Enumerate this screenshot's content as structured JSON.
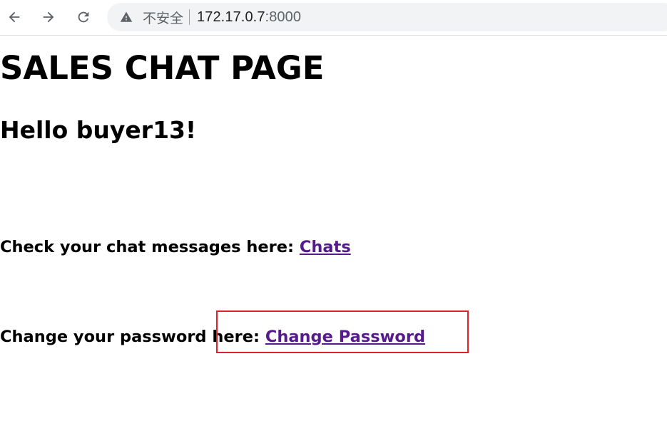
{
  "browser": {
    "security_label": "不安全",
    "url_host": "172.17.0.7",
    "url_port": ":8000"
  },
  "page": {
    "title": "SALES CHAT PAGE",
    "greeting": "Hello buyer13!",
    "chats_prompt": "Check your chat messages here: ",
    "chats_link": "Chats",
    "password_prompt": "Change your password here: ",
    "password_link": "Change Password"
  },
  "colors": {
    "link_visited": "#551a8b",
    "highlight": "#e0202a",
    "omnibox_bg": "#f1f3f4"
  },
  "icons": [
    "back-arrow-icon",
    "forward-arrow-icon",
    "reload-icon",
    "warning-icon"
  ]
}
